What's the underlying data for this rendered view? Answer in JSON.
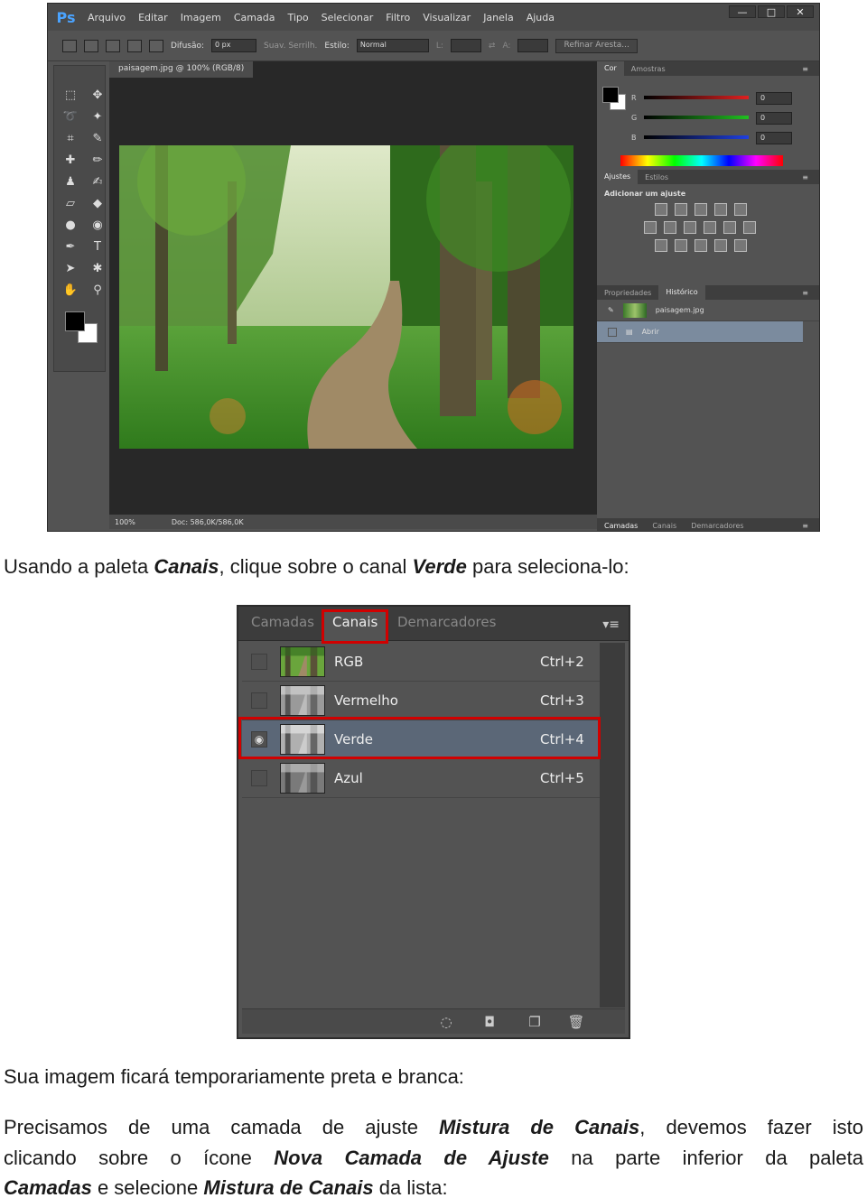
{
  "ps": {
    "logo": "Ps",
    "menu": [
      "Arquivo",
      "Editar",
      "Imagem",
      "Camada",
      "Tipo",
      "Selecionar",
      "Filtro",
      "Visualizar",
      "Janela",
      "Ajuda"
    ],
    "window_buttons": [
      "—",
      "□",
      "✕"
    ],
    "options": {
      "feather_label": "Difusão:",
      "feather_value": "0 px",
      "antialias_label": "Suav. Serrilh.",
      "style_label": "Estilo:",
      "style_value": "Normal",
      "width_label": "L:",
      "height_label": "A:",
      "refine_button": "Refinar Aresta..."
    },
    "doc_tab": "paisagem.jpg @ 100% (RGB/8)",
    "status": {
      "zoom": "100%",
      "doc": "Doc: 586,0K/586,0K"
    },
    "color_panel": {
      "tabs": [
        "Cor",
        "Amostras"
      ],
      "channels": [
        {
          "label": "R",
          "value": "0",
          "color": "#e02020"
        },
        {
          "label": "G",
          "value": "0",
          "color": "#20c020"
        },
        {
          "label": "B",
          "value": "0",
          "color": "#2040e0"
        }
      ]
    },
    "adjust_panel": {
      "tabs": [
        "Ajustes",
        "Estilos"
      ],
      "title": "Adicionar um ajuste"
    },
    "history_panel": {
      "tabs": [
        "Propriedades",
        "Histórico"
      ],
      "items": [
        "paisagem.jpg",
        "Abrir"
      ]
    },
    "bottom_tabs": [
      "Camadas",
      "Canais",
      "Demarcadores"
    ]
  },
  "text": {
    "p1_a": "Usando a paleta ",
    "p1_b": "Canais",
    "p1_c": ", clique sobre o canal ",
    "p1_d": "Verde",
    "p1_e": " para seleciona-lo:",
    "p2": "Sua imagem ficará temporariamente preta e branca:",
    "p3_a": "Precisamos de uma camada de ajuste ",
    "p3_b": "Mistura de Canais",
    "p3_c": ", devemos fazer isto",
    "p4_a": "clicando sobre o ícone ",
    "p4_b": "Nova Camada de Ajuste",
    "p4_c": " na parte inferior da paleta",
    "p5_a": "Camadas",
    "p5_b": " e selecione ",
    "p5_c": "Mistura de Canais",
    "p5_d": " da lista:"
  },
  "channels": {
    "tabs": [
      "Camadas",
      "Canais",
      "Demarcadores"
    ],
    "active_tab": "Canais",
    "rows": [
      {
        "name": "RGB",
        "shortcut": "Ctrl+2",
        "visible": false,
        "selected": false,
        "thumb": "color"
      },
      {
        "name": "Vermelho",
        "shortcut": "Ctrl+3",
        "visible": false,
        "selected": false,
        "thumb": "gray"
      },
      {
        "name": "Verde",
        "shortcut": "Ctrl+4",
        "visible": true,
        "selected": true,
        "thumb": "gray"
      },
      {
        "name": "Azul",
        "shortcut": "Ctrl+5",
        "visible": false,
        "selected": false,
        "thumb": "gray"
      }
    ],
    "highlight_color": "#d10000",
    "bottom_icons": [
      "load-selection-icon",
      "save-selection-icon",
      "new-channel-icon",
      "trash-icon"
    ]
  }
}
